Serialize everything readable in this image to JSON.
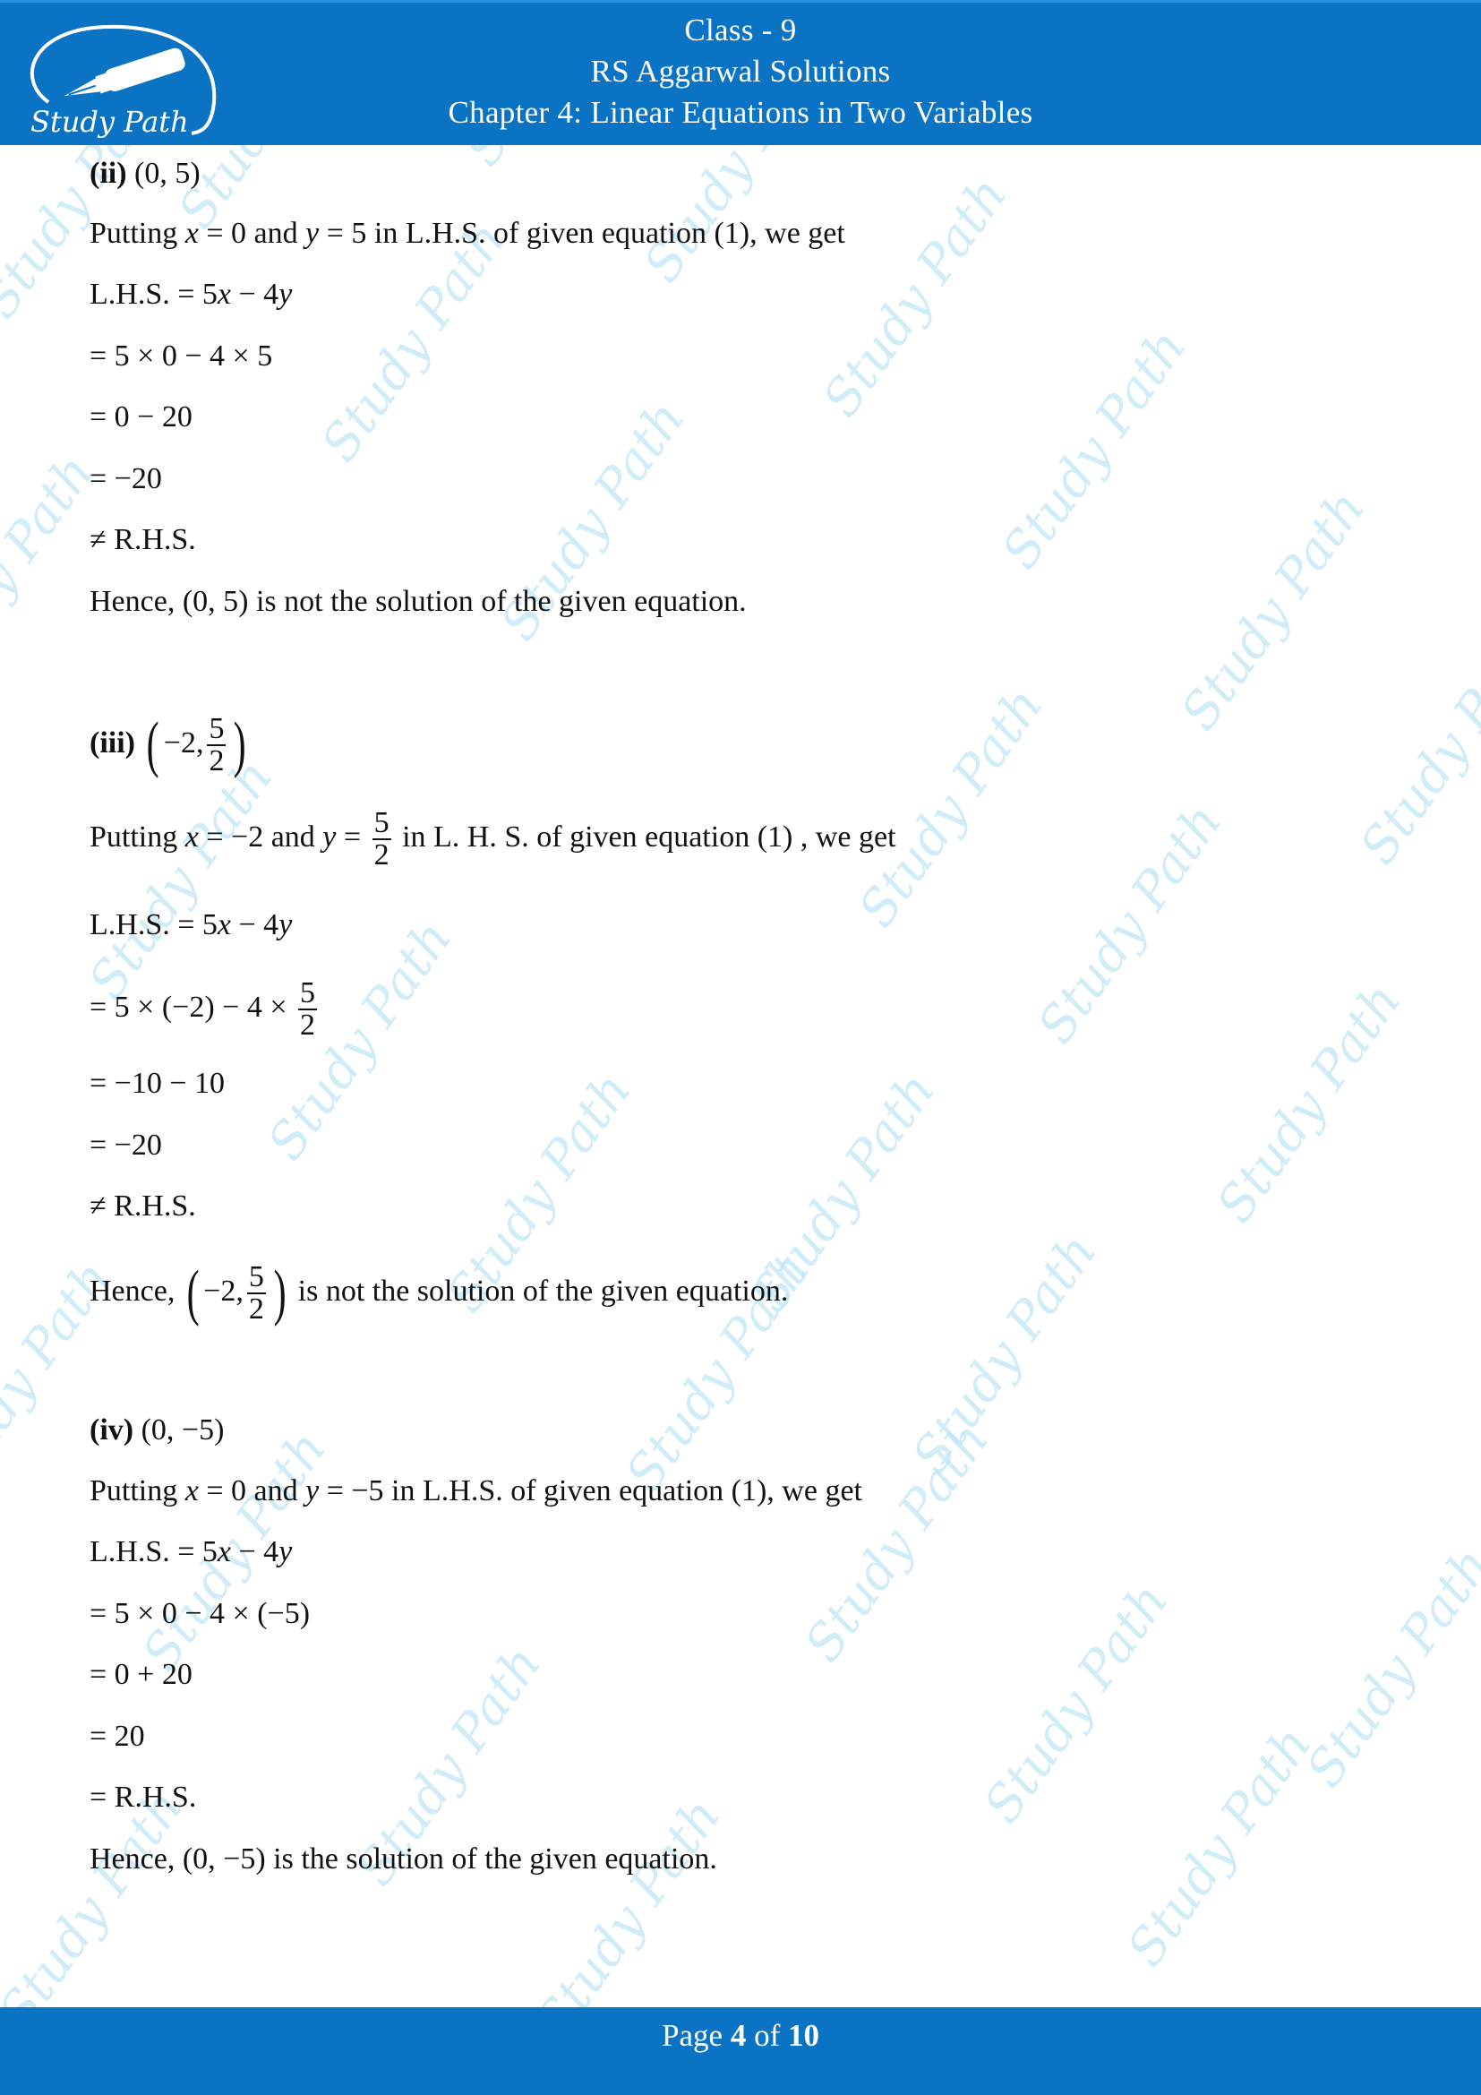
{
  "header": {
    "class_label": "Class - 9",
    "book_title": "RS Aggarwal Solutions",
    "chapter_title": "Chapter 4: Linear Equations in Two Variables",
    "logo_text": "Study Path",
    "background_color": "#0b73c4"
  },
  "watermark_text": "Study Path",
  "parts": {
    "ii": {
      "label": "(ii)",
      "point": "(0, 5)",
      "putting_prefix": "Putting ",
      "x_var": "x",
      "x_eq": " = 0 and ",
      "y_var": "y",
      "y_eq": " = 5 in L.H.S. of given equation (1), we get",
      "lhs_prefix": "L.H.S. = 5",
      "lhs_x": "x",
      "lhs_mid": " − 4",
      "lhs_y": "y",
      "steps": [
        "= 5 × 0 − 4 × 5",
        "= 0 − 20",
        "= −20",
        "≠ R.H.S."
      ],
      "conclusion": "Hence, (0, 5) is not the solution of the given equation."
    },
    "iii": {
      "label": "(iii)",
      "point_x": "−2,",
      "point_y_num": "5",
      "point_y_den": "2",
      "putting_prefix": "Putting ",
      "x_var": "x",
      "x_eq": " = −2 and ",
      "y_var": "y",
      "y_eq": " = ",
      "y_num": "5",
      "y_den": "2",
      "putting_suffix": " in L. H. S. of given equation (1) , we get",
      "lhs_prefix": "L.H.S. = 5",
      "lhs_x": "x",
      "lhs_mid": " − 4",
      "lhs_y": "y",
      "step1_prefix": "=  5 × (−2) − 4 × ",
      "step1_num": "5",
      "step1_den": "2",
      "steps": [
        "= −10 − 10",
        "= −20",
        "≠ R.H.S."
      ],
      "conclusion_prefix": "Hence, ",
      "conclusion_suffix": " is not the solution of the given equation."
    },
    "iv": {
      "label": "(iv)",
      "point": "(0, −5)",
      "putting_prefix": "Putting ",
      "x_var": "x",
      "x_eq": " = 0 and ",
      "y_var": "y",
      "y_eq": " = −5 in L.H.S. of given equation (1), we get",
      "lhs_prefix": "L.H.S. = 5",
      "lhs_x": "x",
      "lhs_mid": " − 4",
      "lhs_y": "y",
      "steps": [
        "= 5 × 0 − 4 × (−5)",
        "= 0 + 20",
        "= 20",
        "= R.H.S."
      ],
      "conclusion": "Hence, (0, −5) is the solution of the given equation."
    }
  },
  "footer": {
    "page_prefix": "Page ",
    "current_page": "4",
    "page_mid": " of ",
    "total_pages": "10"
  }
}
